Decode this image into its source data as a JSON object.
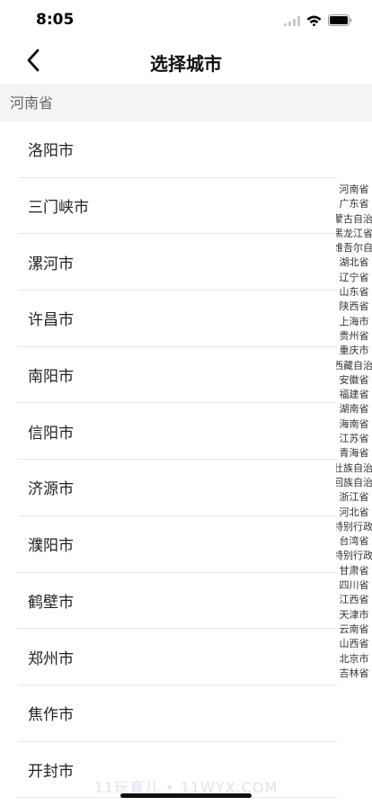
{
  "status": {
    "time": "8:05"
  },
  "nav": {
    "title": "选择城市"
  },
  "section": {
    "title": "河南省"
  },
  "cities": [
    "洛阳市",
    "三门峡市",
    "漯河市",
    "许昌市",
    "南阳市",
    "信阳市",
    "济源市",
    "濮阳市",
    "鹤壁市",
    "郑州市",
    "焦作市",
    "开封市"
  ],
  "index": [
    "河南省",
    "广东省",
    "蒙古自治",
    "黑龙江省",
    "维吾尔自",
    "湖北省",
    "辽宁省",
    "山东省",
    "陕西省",
    "上海市",
    "贵州省",
    "重庆市",
    "西藏自治区",
    "安徽省",
    "福建省",
    "湖南省",
    "海南省",
    "江苏省",
    "青海省",
    "壮族自治",
    "回族自治",
    "浙江省",
    "河北省",
    "特别行政",
    "台湾省",
    "特别行政",
    "甘肃省",
    "四川省",
    "江西省",
    "天津市",
    "云南省",
    "山西省",
    "北京市",
    "吉林省"
  ],
  "watermark": "11玩育儿 • 11WYX.COM",
  "colors": {
    "section_bg": "#f4f4f4",
    "divider": "#e6e6e6",
    "text": "#222222"
  }
}
